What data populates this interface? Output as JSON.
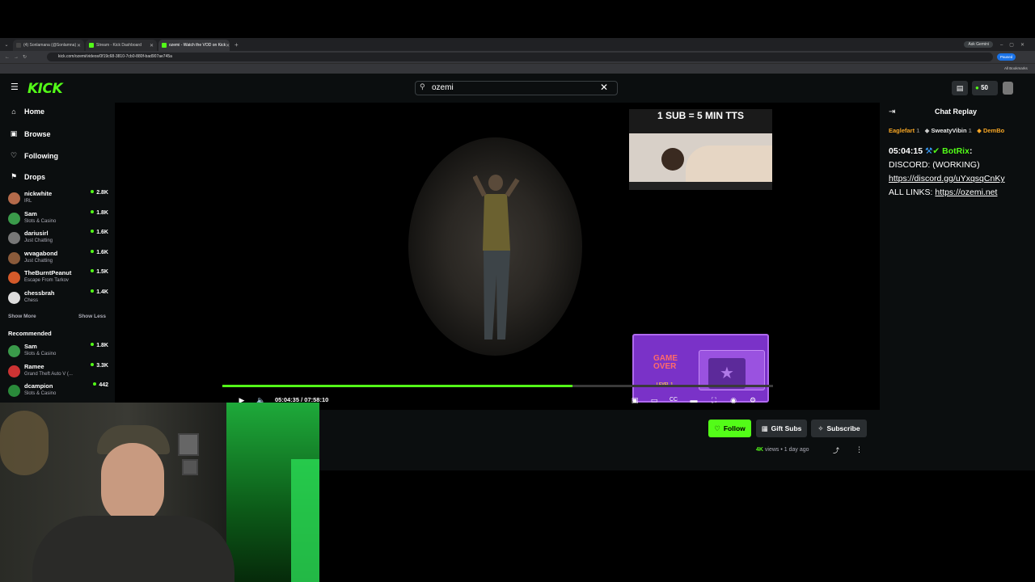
{
  "browser": {
    "tabs": [
      {
        "label": "(4) Sonlamana (@Sonlamna)",
        "active": false,
        "color": "#444"
      },
      {
        "label": "Stream - Kick Dashboard",
        "active": false,
        "color": "#53fc18"
      },
      {
        "label": "ozemi - Watch the VOD on Kick",
        "active": true,
        "color": "#53fc18"
      }
    ],
    "ask_gemini": "Ask Gemini",
    "url": "kick.com/ozemi/videos/0f19c68-3810-7cb0-880f-bad907ae745a",
    "paused": "Paused",
    "all_bookmarks": "All Bookmarks"
  },
  "header": {
    "logo": "KICK",
    "search_value": "ozemi",
    "kicks_count": "50"
  },
  "sidebar": {
    "nav": [
      {
        "label": "Home",
        "icon": "home-icon"
      },
      {
        "label": "Browse",
        "icon": "browse-icon"
      },
      {
        "label": "Following",
        "icon": "heart-icon"
      },
      {
        "label": "Drops",
        "icon": "drops-icon"
      }
    ],
    "following": [
      {
        "name": "nickwhite",
        "category": "IRL",
        "viewers": "2.8K",
        "color": "#b46a4a"
      },
      {
        "name": "Sam",
        "category": "Slots & Casino",
        "viewers": "1.8K",
        "color": "#3a9a4a"
      },
      {
        "name": "dariusirl",
        "category": "Just Chatting",
        "viewers": "1.6K",
        "color": "#777"
      },
      {
        "name": "wvagabond",
        "category": "Just Chatting",
        "viewers": "1.6K",
        "color": "#8a5a3a"
      },
      {
        "name": "TheBurntPeanut",
        "category": "Escape From Tarkov",
        "viewers": "1.5K",
        "color": "#d45a2a"
      },
      {
        "name": "chessbrah",
        "category": "Chess",
        "viewers": "1.4K",
        "color": "#ddd"
      }
    ],
    "show_more": "Show More",
    "show_less": "Show Less",
    "recommended_title": "Recommended",
    "recommended": [
      {
        "name": "Sam",
        "category": "Slots & Casino",
        "viewers": "1.8K",
        "color": "#3a9a4a"
      },
      {
        "name": "Ramee",
        "category": "Grand Theft Auto V (...",
        "viewers": "3.3K",
        "color": "#c33"
      },
      {
        "name": "dcampion",
        "category": "Slots & Casino",
        "viewers": "442",
        "color": "#2a8a3a"
      }
    ]
  },
  "video": {
    "cam_banner": "1 SUB =  5 MIN TTS",
    "overlay_title": "GAME OVER",
    "overlay_sub": "LEVEL 1",
    "current_time": "05:04:35",
    "total_time": "07:58:10",
    "progress": 0.636
  },
  "chat": {
    "title": "Chat Replay",
    "top_gifters": [
      {
        "name": "Eaglefart",
        "count": "1",
        "color": "#f5a524"
      },
      {
        "name": "SweatyVibin",
        "count": "1",
        "color": "#e6e6e6"
      },
      {
        "name": "DemBo",
        "count": "",
        "color": "#f5a524"
      }
    ],
    "message": {
      "time": "05:04:15",
      "user": "BotRix",
      "user_color": "#53fc18",
      "line1": "DISCORD: (WORKING)",
      "link1": "https://discord.gg/uYxqsqCnKy",
      "line2_prefix": "ALL LINKS: ",
      "link2": "https://ozemi.net"
    }
  },
  "actions": {
    "follow": "Follow",
    "gift": "Gift Subs",
    "subscribe": "Subscribe",
    "views_count": "4K",
    "views_label": "views",
    "ago": "1 day ago"
  }
}
